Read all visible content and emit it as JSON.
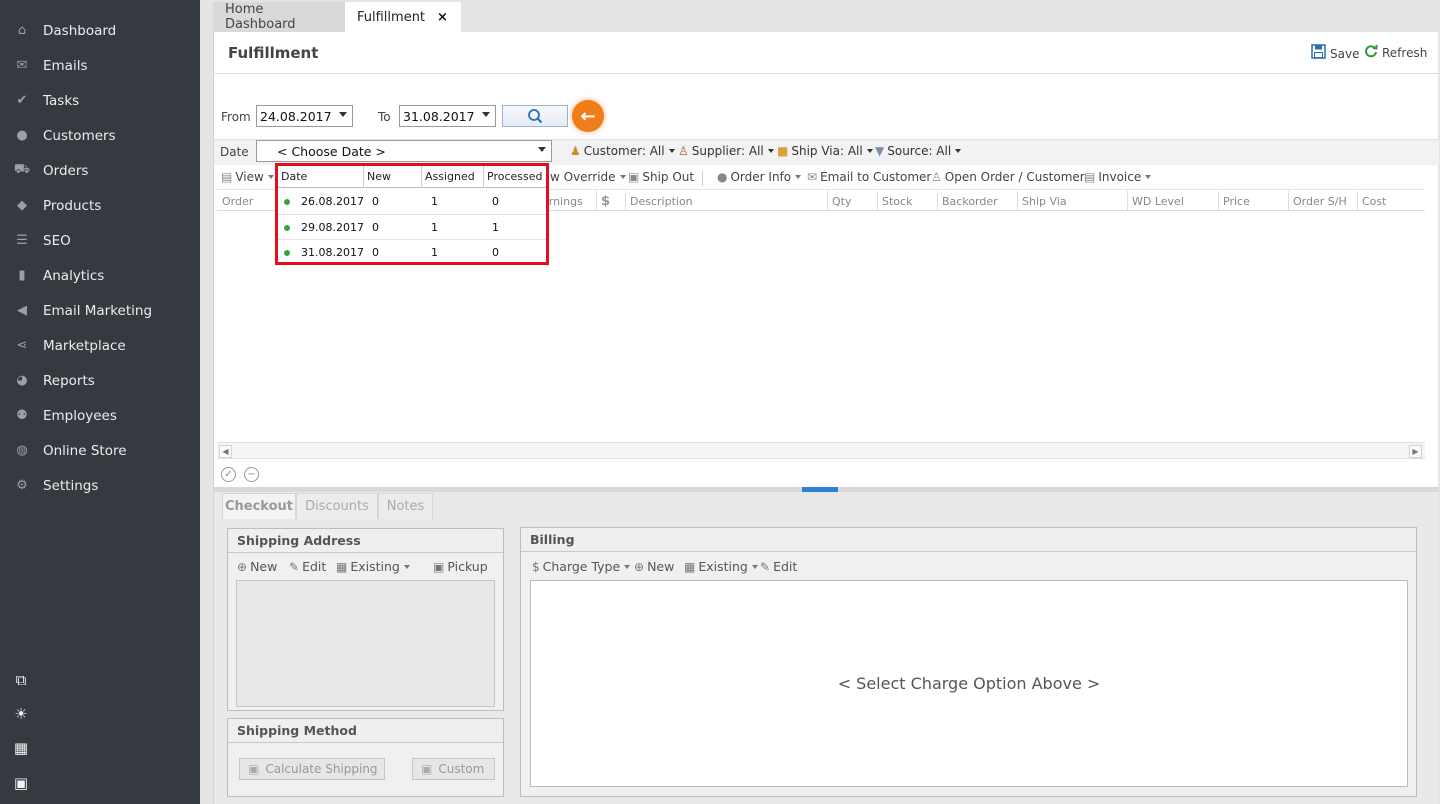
{
  "sidebar": {
    "items": [
      {
        "label": "Dashboard",
        "icon": "home-icon",
        "glyph": "⌂"
      },
      {
        "label": "Emails",
        "icon": "envelope-icon",
        "glyph": "✉"
      },
      {
        "label": "Tasks",
        "icon": "tasks-icon",
        "glyph": "✔"
      },
      {
        "label": "Customers",
        "icon": "user-icon",
        "glyph": "●"
      },
      {
        "label": "Orders",
        "icon": "cart-icon",
        "glyph": "⛟"
      },
      {
        "label": "Products",
        "icon": "tag-icon",
        "glyph": "◆"
      },
      {
        "label": "SEO",
        "icon": "sliders-icon",
        "glyph": "☰"
      },
      {
        "label": "Analytics",
        "icon": "bar-chart-icon",
        "glyph": "▮"
      },
      {
        "label": "Email Marketing",
        "icon": "megaphone-icon",
        "glyph": "◀"
      },
      {
        "label": "Marketplace",
        "icon": "share-icon",
        "glyph": "⋖"
      },
      {
        "label": "Reports",
        "icon": "pie-chart-icon",
        "glyph": "◕"
      },
      {
        "label": "Employees",
        "icon": "users-icon",
        "glyph": "⚉"
      },
      {
        "label": "Online Store",
        "icon": "globe-icon",
        "glyph": "◍"
      },
      {
        "label": "Settings",
        "icon": "gear-icon",
        "glyph": "⚙"
      }
    ],
    "tools": [
      {
        "icon": "windows-icon",
        "glyph": "⧉"
      },
      {
        "icon": "lightbulb-icon",
        "glyph": "☀"
      },
      {
        "icon": "calculator-icon",
        "glyph": "▦"
      },
      {
        "icon": "calendar-icon",
        "glyph": "▣"
      }
    ]
  },
  "tabs": [
    {
      "label": "Home Dashboard"
    },
    {
      "label": "Fulfillment",
      "close": "×"
    }
  ],
  "header": {
    "title": "Fulfillment",
    "save": "Save",
    "refresh": "Refresh"
  },
  "filters": {
    "from_label": "From",
    "from_value": "24.08.2017",
    "to_label": "To",
    "to_value": "31.08.2017",
    "date_label": "Date",
    "date_value": "< Choose Date >",
    "customer": "Customer: All",
    "supplier": "Supplier: All",
    "ship_via": "Ship Via: All",
    "source": "Source: All"
  },
  "toolbar": {
    "view": "View",
    "override": "w Override",
    "ship_out": "Ship Out",
    "order_info": "Order Info",
    "email_customer": "Email to Customer",
    "open_order": "Open Order / Customer",
    "invoice": "Invoice"
  },
  "grid": {
    "columns": [
      "Order",
      "arnings",
      "$",
      "Description",
      "Qty",
      "Stock",
      "Backorder",
      "Ship Via",
      "WD Level",
      "Price",
      "Order S/H",
      "Cost"
    ]
  },
  "date_popup": {
    "headers": [
      "Date",
      "New",
      "Assigned",
      "Processed"
    ],
    "rows": [
      [
        "26.08.2017",
        "0",
        "1",
        "0"
      ],
      [
        "29.08.2017",
        "0",
        "1",
        "1"
      ],
      [
        "31.08.2017",
        "0",
        "1",
        "0"
      ]
    ]
  },
  "bottom_tabs": [
    "Checkout",
    "Discounts",
    "Notes"
  ],
  "shipping_address": {
    "title": "Shipping Address",
    "new": "New",
    "edit": "Edit",
    "existing": "Existing",
    "pickup": "Pickup"
  },
  "shipping_method": {
    "title": "Shipping Method",
    "calculate": "Calculate Shipping",
    "custom": "Custom"
  },
  "billing": {
    "title": "Billing",
    "charge_type": "Charge Type",
    "new": "New",
    "existing": "Existing",
    "edit": "Edit",
    "placeholder": "< Select Charge Option Above >"
  },
  "colors": {
    "sidebar_bg": "#353a40",
    "accent_orange": "#f07d1a",
    "highlight_red": "#e0101c",
    "status_dot": "#3aa23a",
    "splitter_blue": "#2f7fd6"
  }
}
